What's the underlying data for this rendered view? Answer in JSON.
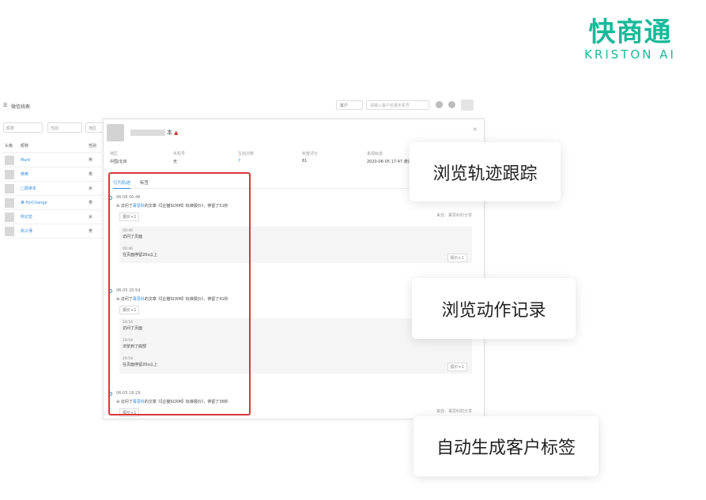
{
  "logo": {
    "cn": "快商通",
    "en": "KRISTON AI"
  },
  "app_header": {
    "menu_icon": "☰",
    "title": "微信线索",
    "customer_select": "客户",
    "search_placeholder": "请输入客户名或手机号"
  },
  "filters": [
    "昵称",
    "性别",
    "地区"
  ],
  "list": {
    "headers": [
      "头像",
      "昵称",
      "性别"
    ],
    "rows": [
      {
        "name": "Mark",
        "gender": "男"
      },
      {
        "name": "英英",
        "gender": "男"
      },
      {
        "name": "□源读本",
        "gender": "女"
      },
      {
        "name": "美 ForChange",
        "gender": "男"
      },
      {
        "name": "阿记龙",
        "gender": "女"
      },
      {
        "name": "帆义薄",
        "gender": "男"
      }
    ]
  },
  "dialog": {
    "name_suffix": "本",
    "pin": "▲",
    "close": "×",
    "info": [
      {
        "label": "地区",
        "value": "中国/北京"
      },
      {
        "label": "手机号",
        "value": "无"
      },
      {
        "label": "互动次数",
        "value": "7"
      },
      {
        "label": "标签评分",
        "value": "61"
      },
      {
        "label": "来源轨迹",
        "value": "2020-06-05 17:47 通过 微"
      }
    ],
    "tabs": [
      "行为轨迹",
      "标签"
    ],
    "events": [
      {
        "time": "06-06 00:46",
        "desc_prefix": "访问了",
        "desc_link": "菁思科",
        "desc_suffix": "的文章《【企猫SCRM】标准报价》，停留了51秒",
        "tag": "报价+1",
        "source": "来自：菁思科的分享",
        "items": [
          {
            "t": "00:46",
            "d": "访问了页面"
          },
          {
            "t": "00:46",
            "d": "在页面停留20s以上"
          }
        ],
        "box_tag": "报价+1"
      },
      {
        "time": "06-05 20:54",
        "desc_prefix": "访问了",
        "desc_link": "菁思科",
        "desc_suffix": "的文章《【企猫SCRM】标准报价》，停留了41秒",
        "tag": "报价+1",
        "source": "",
        "items": [
          {
            "t": "20:54",
            "d": "访问了页面"
          },
          {
            "t": "20:54",
            "d": "浏览到了底部"
          },
          {
            "t": "20:54",
            "d": "在页面停留20s以上"
          }
        ],
        "box_tag": "报价+1"
      },
      {
        "time": "06-05 18:29",
        "desc_prefix": "访问了",
        "desc_link": "菁思科",
        "desc_suffix": "的文章《【企猫SCRM】标准报价》，停留了36秒",
        "tag": "报价+1",
        "source": "来自：菁思科的分享",
        "items": [],
        "box_tag": ""
      }
    ]
  },
  "callouts": [
    "浏览轨迹跟踪",
    "浏览动作记录",
    "自动生成客户标签"
  ]
}
